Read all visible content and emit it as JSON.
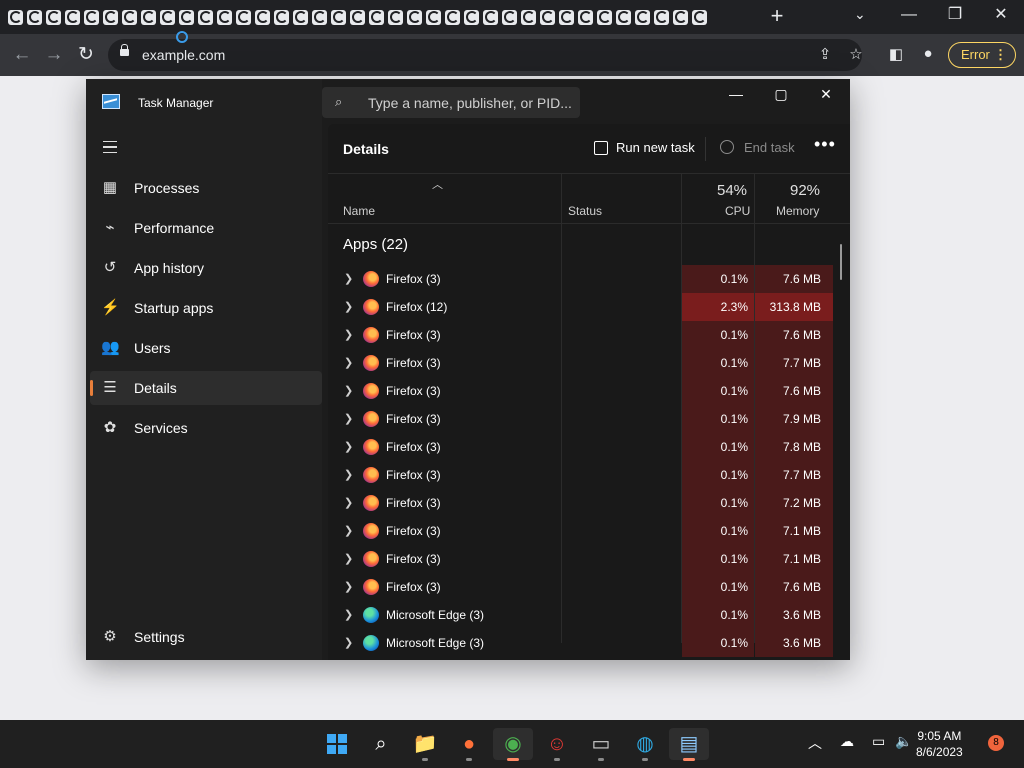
{
  "browser": {
    "tab_count": 37,
    "new_tab": "+",
    "tab_menu": "⌄",
    "url": "example.com",
    "error_label": "Error"
  },
  "task_manager": {
    "title": "Task Manager",
    "search_placeholder": "Type a name, publisher, or PID...",
    "nav": [
      {
        "label": "Processes",
        "icon": "processes-icon",
        "glyph": "▦"
      },
      {
        "label": "Performance",
        "icon": "performance-icon",
        "glyph": "⌁"
      },
      {
        "label": "App history",
        "icon": "app-history-icon",
        "glyph": "↺"
      },
      {
        "label": "Startup apps",
        "icon": "startup-apps-icon",
        "glyph": "⚡"
      },
      {
        "label": "Users",
        "icon": "users-icon",
        "glyph": "👥"
      },
      {
        "label": "Details",
        "icon": "details-icon",
        "glyph": "☰",
        "active": true
      },
      {
        "label": "Services",
        "icon": "services-icon",
        "glyph": "✿"
      }
    ],
    "settings_label": "Settings",
    "page_title": "Details",
    "run_new_task": "Run new task",
    "end_task": "End task",
    "columns": {
      "name": "Name",
      "status": "Status",
      "cpu_pct": "54%",
      "cpu": "CPU",
      "mem_pct": "92%",
      "mem": "Memory"
    },
    "group_label": "Apps (22)",
    "rows": [
      {
        "name": "Firefox (3)",
        "icon": "firefox",
        "cpu": "0.1%",
        "mem": "7.6 MB"
      },
      {
        "name": "Firefox (12)",
        "icon": "firefox",
        "cpu": "2.3%",
        "mem": "313.8 MB",
        "hot": true
      },
      {
        "name": "Firefox (3)",
        "icon": "firefox",
        "cpu": "0.1%",
        "mem": "7.6 MB"
      },
      {
        "name": "Firefox (3)",
        "icon": "firefox",
        "cpu": "0.1%",
        "mem": "7.7 MB"
      },
      {
        "name": "Firefox (3)",
        "icon": "firefox",
        "cpu": "0.1%",
        "mem": "7.6 MB"
      },
      {
        "name": "Firefox (3)",
        "icon": "firefox",
        "cpu": "0.1%",
        "mem": "7.9 MB"
      },
      {
        "name": "Firefox (3)",
        "icon": "firefox",
        "cpu": "0.1%",
        "mem": "7.8 MB"
      },
      {
        "name": "Firefox (3)",
        "icon": "firefox",
        "cpu": "0.1%",
        "mem": "7.7 MB"
      },
      {
        "name": "Firefox (3)",
        "icon": "firefox",
        "cpu": "0.1%",
        "mem": "7.2 MB"
      },
      {
        "name": "Firefox (3)",
        "icon": "firefox",
        "cpu": "0.1%",
        "mem": "7.1 MB"
      },
      {
        "name": "Firefox (3)",
        "icon": "firefox",
        "cpu": "0.1%",
        "mem": "7.1 MB"
      },
      {
        "name": "Firefox (3)",
        "icon": "firefox",
        "cpu": "0.1%",
        "mem": "7.6 MB"
      },
      {
        "name": "Microsoft Edge (3)",
        "icon": "edge",
        "cpu": "0.1%",
        "mem": "3.6 MB"
      },
      {
        "name": "Microsoft Edge (3)",
        "icon": "edge",
        "cpu": "0.1%",
        "mem": "3.6 MB"
      }
    ]
  },
  "taskbar": {
    "apps": [
      {
        "name": "start-button",
        "icon": "windows-logo"
      },
      {
        "name": "search-button",
        "icon": "search-icon"
      },
      {
        "name": "file-explorer",
        "icon": "folder-icon"
      },
      {
        "name": "firefox",
        "icon": "firefox-icon"
      },
      {
        "name": "chrome",
        "icon": "chrome-icon",
        "active": true
      },
      {
        "name": "app-character",
        "icon": "character-icon"
      },
      {
        "name": "terminal",
        "icon": "terminal-icon"
      },
      {
        "name": "edge",
        "icon": "edge-icon"
      },
      {
        "name": "task-manager",
        "icon": "task-manager-icon",
        "active": true
      }
    ],
    "time": "9:05 AM",
    "date": "8/6/2023",
    "notification_count": "8"
  },
  "colors": {
    "accent": "#e87f3b",
    "cpu_cell": "#4a1a1a",
    "hot_cell": "#7a1d1d",
    "error": "#fdd663"
  }
}
